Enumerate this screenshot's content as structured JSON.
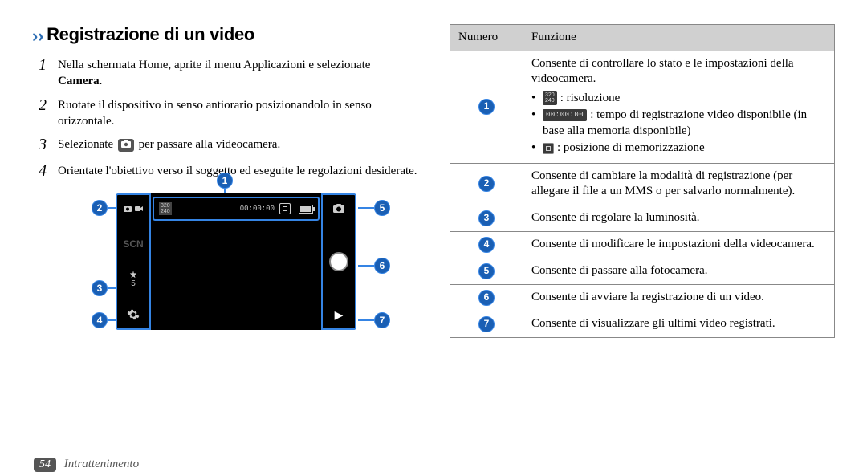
{
  "heading": "Registrazione di un video",
  "steps": [
    {
      "num": "1",
      "text_a": "Nella schermata Home, aprite il menu Applicazioni e selezionate ",
      "bold": "Camera",
      "text_b": "."
    },
    {
      "num": "2",
      "text_a": "Ruotate il dispositivo in senso antiorario posizionandolo in senso orizzontale.",
      "bold": "",
      "text_b": ""
    },
    {
      "num": "3",
      "text_a": "Selezionate ",
      "icon": true,
      "text_b": " per passare alla videocamera."
    },
    {
      "num": "4",
      "text_a": "Orientate l'obiettivo verso il soggetto ed eseguite le regolazioni desiderate.",
      "bold": "",
      "text_b": ""
    }
  ],
  "cam_mock": {
    "resolution": "320\n240",
    "timer": "00:00:00",
    "scn": "SCN",
    "bright_num": "5"
  },
  "table": {
    "headers": [
      "Numero",
      "Funzione"
    ],
    "rows": [
      {
        "num": "1",
        "text": "Consente di controllare lo stato e le impostazioni della videocamera.",
        "sub": [
          {
            "icon": "res",
            "text": ": risoluzione"
          },
          {
            "icon": "time",
            "text": ": tempo di registrazione video disponibile (in base alla memoria disponibile)"
          },
          {
            "icon": "store",
            "text": ": posizione di memorizzazione"
          }
        ]
      },
      {
        "num": "2",
        "text": "Consente di cambiare la modalità di registrazione (per allegare il file a un MMS o per salvarlo normalmente)."
      },
      {
        "num": "3",
        "text": "Consente di regolare la luminosità."
      },
      {
        "num": "4",
        "text": "Consente di modificare le impostazioni della videocamera."
      },
      {
        "num": "5",
        "text": "Consente di passare alla fotocamera."
      },
      {
        "num": "6",
        "text": "Consente di avviare la registrazione di un video."
      },
      {
        "num": "7",
        "text": "Consente di visualizzare gli ultimi video registrati."
      }
    ]
  },
  "footer": {
    "page_num": "54",
    "section": "Intrattenimento"
  }
}
